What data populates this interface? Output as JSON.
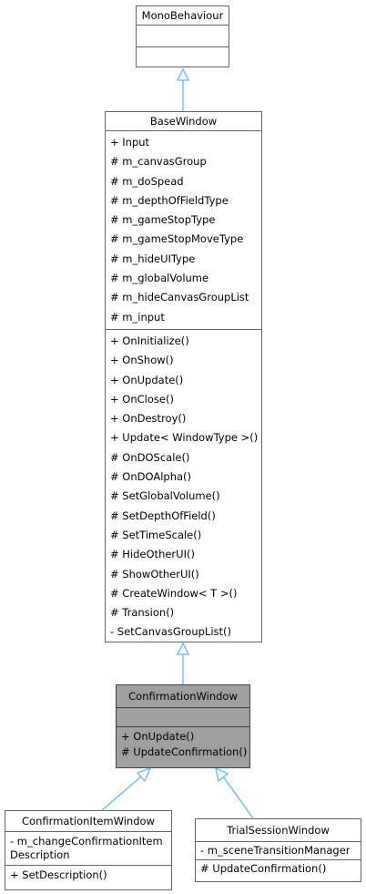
{
  "classes": {
    "mono": {
      "name": "MonoBehaviour"
    },
    "base": {
      "name": "BaseWindow",
      "attributes": [
        "+ Input",
        "# m_canvasGroup",
        "# m_doSpead",
        "# m_depthOfFieldType",
        "# m_gameStopType",
        "# m_gameStopMoveType",
        "# m_hideUIType",
        "# m_globalVolume",
        "# m_hideCanvasGroupList",
        "# m_input"
      ],
      "methods": [
        "+ OnInitialize()",
        "+ OnShow()",
        "+ OnUpdate()",
        "+ OnClose()",
        "+ OnDestroy()",
        "+ Update< WindowType >()",
        "# OnDOScale()",
        "# OnDOAlpha()",
        "# SetGlobalVolume()",
        "# SetDepthOfField()",
        "# SetTimeScale()",
        "# HideOtherUI()",
        "# ShowOtherUI()",
        "# CreateWindow< T >()",
        "# Transion()",
        "-  SetCanvasGroupList()"
      ]
    },
    "confirm": {
      "name": "ConfirmationWindow",
      "methods": [
        "+ OnUpdate()",
        "# UpdateConfirmation()"
      ]
    },
    "item": {
      "name": "ConfirmationItemWindow",
      "attributes": [
        "-  m_changeConfirmationItem Description"
      ],
      "methods": [
        "+ SetDescription()"
      ]
    },
    "trial": {
      "name": "TrialSessionWindow",
      "attributes": [
        "-  m_sceneTransitionManager"
      ],
      "methods": [
        "# UpdateConfirmation()"
      ]
    }
  },
  "colors": {
    "edge": "#63b8ff",
    "highlight": "#a0a0a0",
    "border": "#666666"
  }
}
